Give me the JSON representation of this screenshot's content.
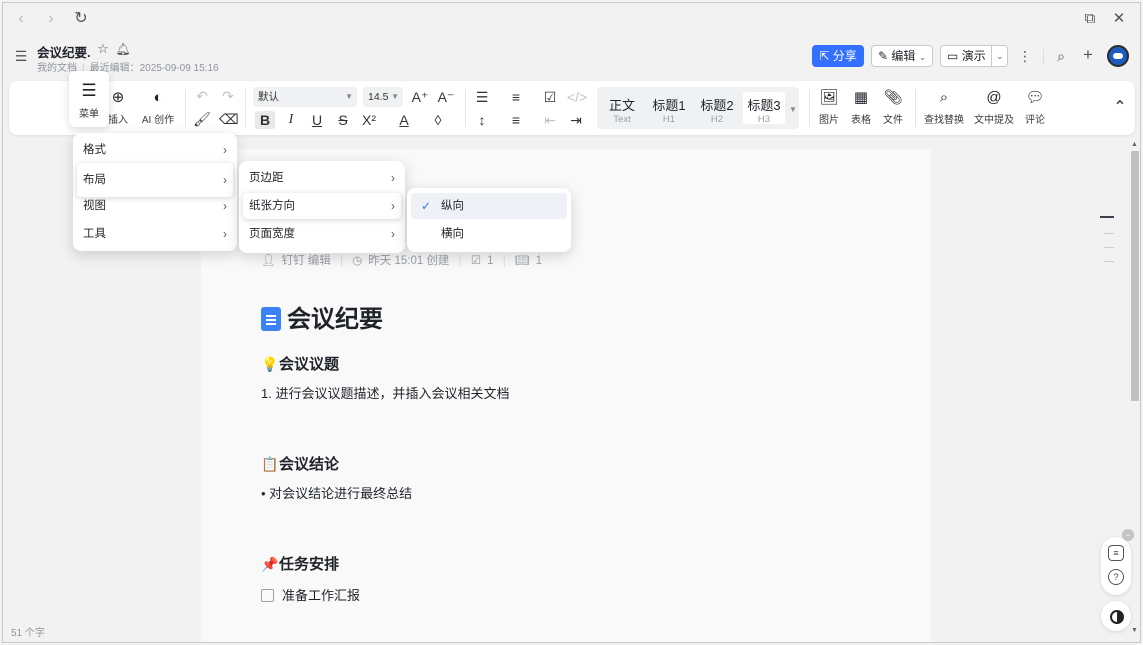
{
  "doc": {
    "title": "会议纪要.",
    "location": "我的文档",
    "last_edit": "最近编辑：2025-09-09 15:16"
  },
  "header": {
    "share": "分享",
    "edit": "编辑",
    "present": "演示"
  },
  "toolbar": {
    "menu": "菜单",
    "insert": "插入",
    "ai": "AI 创作",
    "font": "默认",
    "size": "14.5",
    "styles": [
      {
        "label": "正文",
        "sub": "Text"
      },
      {
        "label": "标题1",
        "sub": "H1"
      },
      {
        "label": "标题2",
        "sub": "H2"
      },
      {
        "label": "标题3",
        "sub": "H3"
      }
    ],
    "image": "图片",
    "table": "表格",
    "file": "文件",
    "find": "查找替换",
    "mention": "文中提及",
    "comment": "评论"
  },
  "menu_main": [
    "格式",
    "布局",
    "视图",
    "工具"
  ],
  "menu_layout": [
    "页边距",
    "纸张方向",
    "页面宽度"
  ],
  "menu_orientation": [
    "纵向",
    "横向"
  ],
  "content": {
    "meta_author": "钉钉 编辑",
    "meta_time": "昨天 15:01 创建",
    "meta_tasks": "1",
    "meta_reads": "1",
    "h1": "会议纪要",
    "s1_title": "会议议题",
    "s1_item": "1.  进行会议议题描述，并插入会议相关文档",
    "s2_title": "会议结论",
    "s2_item": "• 对会议结论进行最终总结",
    "s3_title": "任务安排",
    "s3_item": "准备工作汇报"
  },
  "status": {
    "word_count": "51 个字"
  },
  "colors": {
    "accent": "#3370ff",
    "doc_icon": "#3b82f6"
  }
}
